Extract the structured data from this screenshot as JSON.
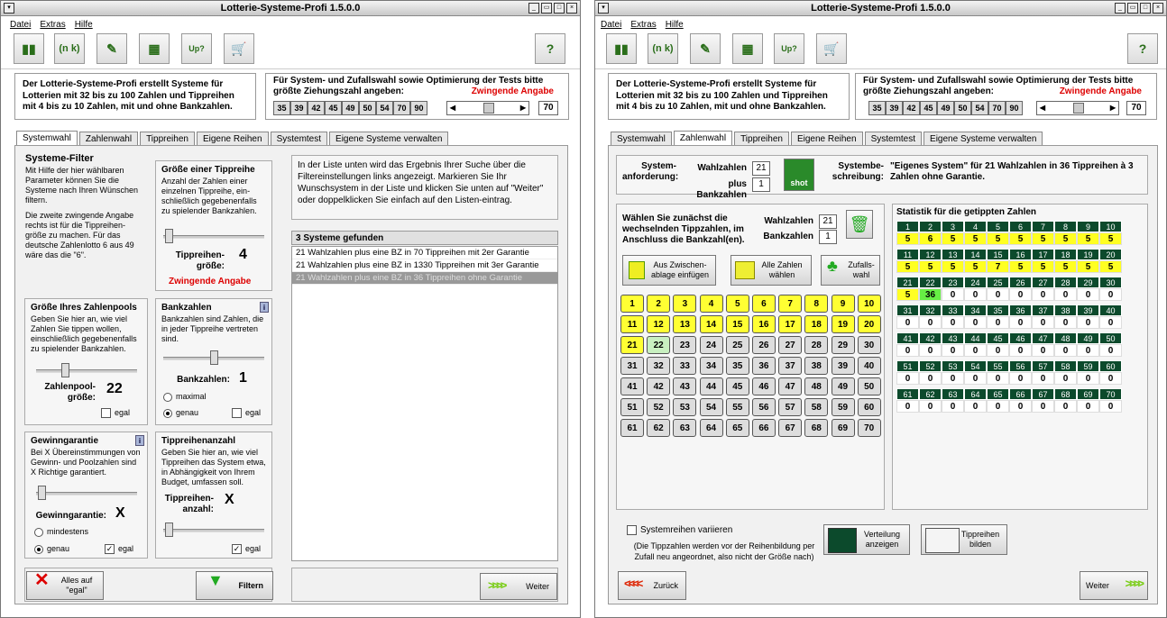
{
  "app": {
    "title": "Lotterie-Systeme-Profi 1.5.0.0",
    "menu": [
      "Datei",
      "Extras",
      "Hilfe"
    ],
    "toolbar": {
      "nk": "(n\nk)",
      "update": "Update ?"
    }
  },
  "header": {
    "info": "Der Lotterie-Systeme-Profi erstellt Systeme für Lotterien mit 32 bis zu 100 Zahlen und Tippreihen mit 4 bis zu 10 Zahlen, mit und ohne Bankzahlen.",
    "ziehung_text": "Für System- und Zufallswahl sowie Optimierung der Tests bitte größte Ziehungszahl angeben:",
    "zwingend": "Zwingende Angabe",
    "numbers": [
      "35",
      "39",
      "42",
      "45",
      "49",
      "50",
      "54",
      "70",
      "90"
    ],
    "value": "70"
  },
  "tabs": [
    "Systemwahl",
    "Zahlenwahl",
    "Tippreihen",
    "Eigene Reihen",
    "Systemtest",
    "Eigene Systeme verwalten"
  ],
  "left": {
    "filter": {
      "title": "Systeme-Filter",
      "text1": "Mit Hilfe der hier wählbaren Parameter können Sie die Systeme nach Ihren Wünschen filtern.",
      "text2": "Die zweite zwingende Angabe rechts ist für die Tippreihen-größe zu machen. Für das deutsche Zahlenlotto 6 aus 49 wäre das die \"6\"."
    },
    "tipp": {
      "title": "Größe einer Tippreihe",
      "text": "Anzahl der Zahlen einer einzelnen Tippreihe, ein-schließlich gegebenenfalls zu spielender Bankzahlen.",
      "label": "Tippreihen-größe:",
      "value": "4",
      "zwingend": "Zwingende Angabe"
    },
    "pool": {
      "title": "Größe Ihres Zahlenpools",
      "text": "Geben Sie hier an, wie viel Zahlen Sie tippen wollen, einschließlich gegebenenfalls zu spielender Bankzahlen.",
      "label": "Zahlenpool-größe:",
      "value": "22",
      "egal": "egal"
    },
    "bank": {
      "title": "Bankzahlen",
      "text": "Bankzahlen sind Zahlen, die in jeder Tippreihe vertreten sind.",
      "label": "Bankzahlen:",
      "value": "1",
      "maximal": "maximal",
      "genau": "genau",
      "egal": "egal"
    },
    "gewinn": {
      "title": "Gewinngarantie",
      "text": "Bei X Übereinstimmungen von Gewinn- und Poolzahlen sind X Richtige garantiert.",
      "label": "Gewinngarantie:",
      "value": "X",
      "mindestens": "mindestens",
      "genau": "genau",
      "egal": "egal"
    },
    "anzahl": {
      "title": "Tippreihenanzahl",
      "text": "Geben Sie hier an, wie viel Tippreihen das System etwa, in Abhängigkeit von Ihrem Budget, umfassen soll.",
      "label": "Tippreihen-anzahl:",
      "value": "X",
      "egal": "egal"
    },
    "info": "In der Liste unten wird das Ergebnis Ihrer Suche über die Filtereinstellungen links angezeigt. Markieren Sie Ihr Wunschsystem in der Liste und klicken Sie unten auf \"Weiter\" oder doppelklicken Sie einfach auf den Listen-eintrag.",
    "found": "3 Systeme gefunden",
    "results": [
      "21 Wahlzahlen plus eine BZ in 70 Tippreihen mit 2er Garantie",
      "21 Wahlzahlen plus eine BZ in 1330 Tippreihen mit 3er Garantie",
      "21 Wahlzahlen plus eine BZ in 36 Tippreihen ohne Garantie"
    ],
    "btn_egal": "Alles auf \"egal\"",
    "btn_filter": "Filtern",
    "btn_weiter": "Weiter"
  },
  "right": {
    "anf_label": "System-anforderung:",
    "wahl_label": "Wahlzahlen",
    "wahl_val": "21",
    "bz_label": "plus Bankzahlen",
    "bz_val": "1",
    "shot": "shot",
    "beschr_label": "Systembe-schreibung:",
    "beschr": "\"Eigenes System\" für 21 Wahlzahlen in 36 Tippreihen à 3 Zahlen ohne Garantie.",
    "instr": "Wählen Sie zunächst die wechselnden Tippzahlen, im Anschluss die Bankzahl(en).",
    "w_label": "Wahlzahlen",
    "w_val": "21",
    "b_label": "Bankzahlen",
    "b_val": "1",
    "btn_clip": "Aus Zwischen-ablage einfügen",
    "btn_all": "Alle Zahlen wählen",
    "btn_rand": "Zufalls-wahl",
    "stat_title": "Statistik für die getippten Zahlen",
    "stat_values": [
      "5",
      "6",
      "5",
      "5",
      "5",
      "5",
      "5",
      "5",
      "5",
      "5",
      "5",
      "5",
      "5",
      "5",
      "7",
      "5",
      "5",
      "5",
      "5",
      "5",
      "5",
      "36",
      "0",
      "0",
      "0",
      "0",
      "0",
      "0",
      "0",
      "0"
    ],
    "variieren": "Systemreihen variieren",
    "variieren_note": "(Die Tippzahlen werden vor der Reihenbildung per Zufall neu angeordnet, also nicht der Größe nach)",
    "btn_vert": "Verteilung anzeigen",
    "btn_tipp": "Tippreihen bilden",
    "btn_zurueck": "Zurück",
    "btn_weiter": "Weiter"
  },
  "colors": {
    "yellow": "#ffff33",
    "green": "#c8f0c0",
    "dark": "#0c4a2c",
    "red": "#dd0000"
  }
}
